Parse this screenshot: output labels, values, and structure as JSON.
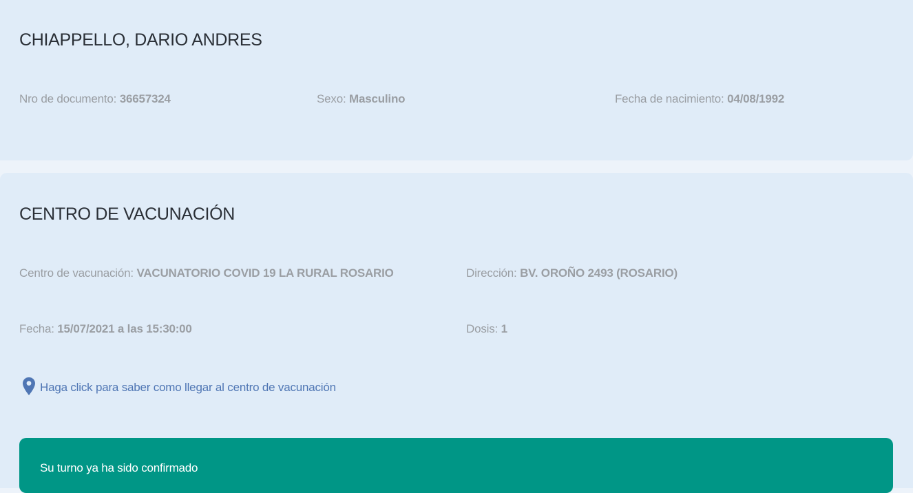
{
  "person": {
    "name": "CHIAPPELLO, DARIO ANDRES",
    "document_label": "Nro de documento: ",
    "document_value": "36657324",
    "sex_label": "Sexo: ",
    "sex_value": "Masculino",
    "birth_label": "Fecha de nacimiento: ",
    "birth_value": "04/08/1992"
  },
  "center": {
    "title": "CENTRO DE VACUNACIÓN",
    "center_label": "Centro de vacunación: ",
    "center_value": "VACUNATORIO COVID 19 LA RURAL ROSARIO",
    "address_label": "Dirección: ",
    "address_value": "BV. OROÑO 2493 (ROSARIO)",
    "date_label": "Fecha: ",
    "date_value": "15/07/2021 a las 15:30:00",
    "dose_label": "Dosis: ",
    "dose_value": "1",
    "map_link_text": "Haga click para saber como llegar al centro de vacunación",
    "map_icon": "map-pin-icon"
  },
  "confirmation": {
    "message": "Su turno ya ha sido confirmado"
  },
  "colors": {
    "page_background": "#edf3fa",
    "card_background": "#e0ecf8",
    "confirm_background": "#009686",
    "link": "#4f76b4",
    "label_gray": "#9a9ea3"
  }
}
